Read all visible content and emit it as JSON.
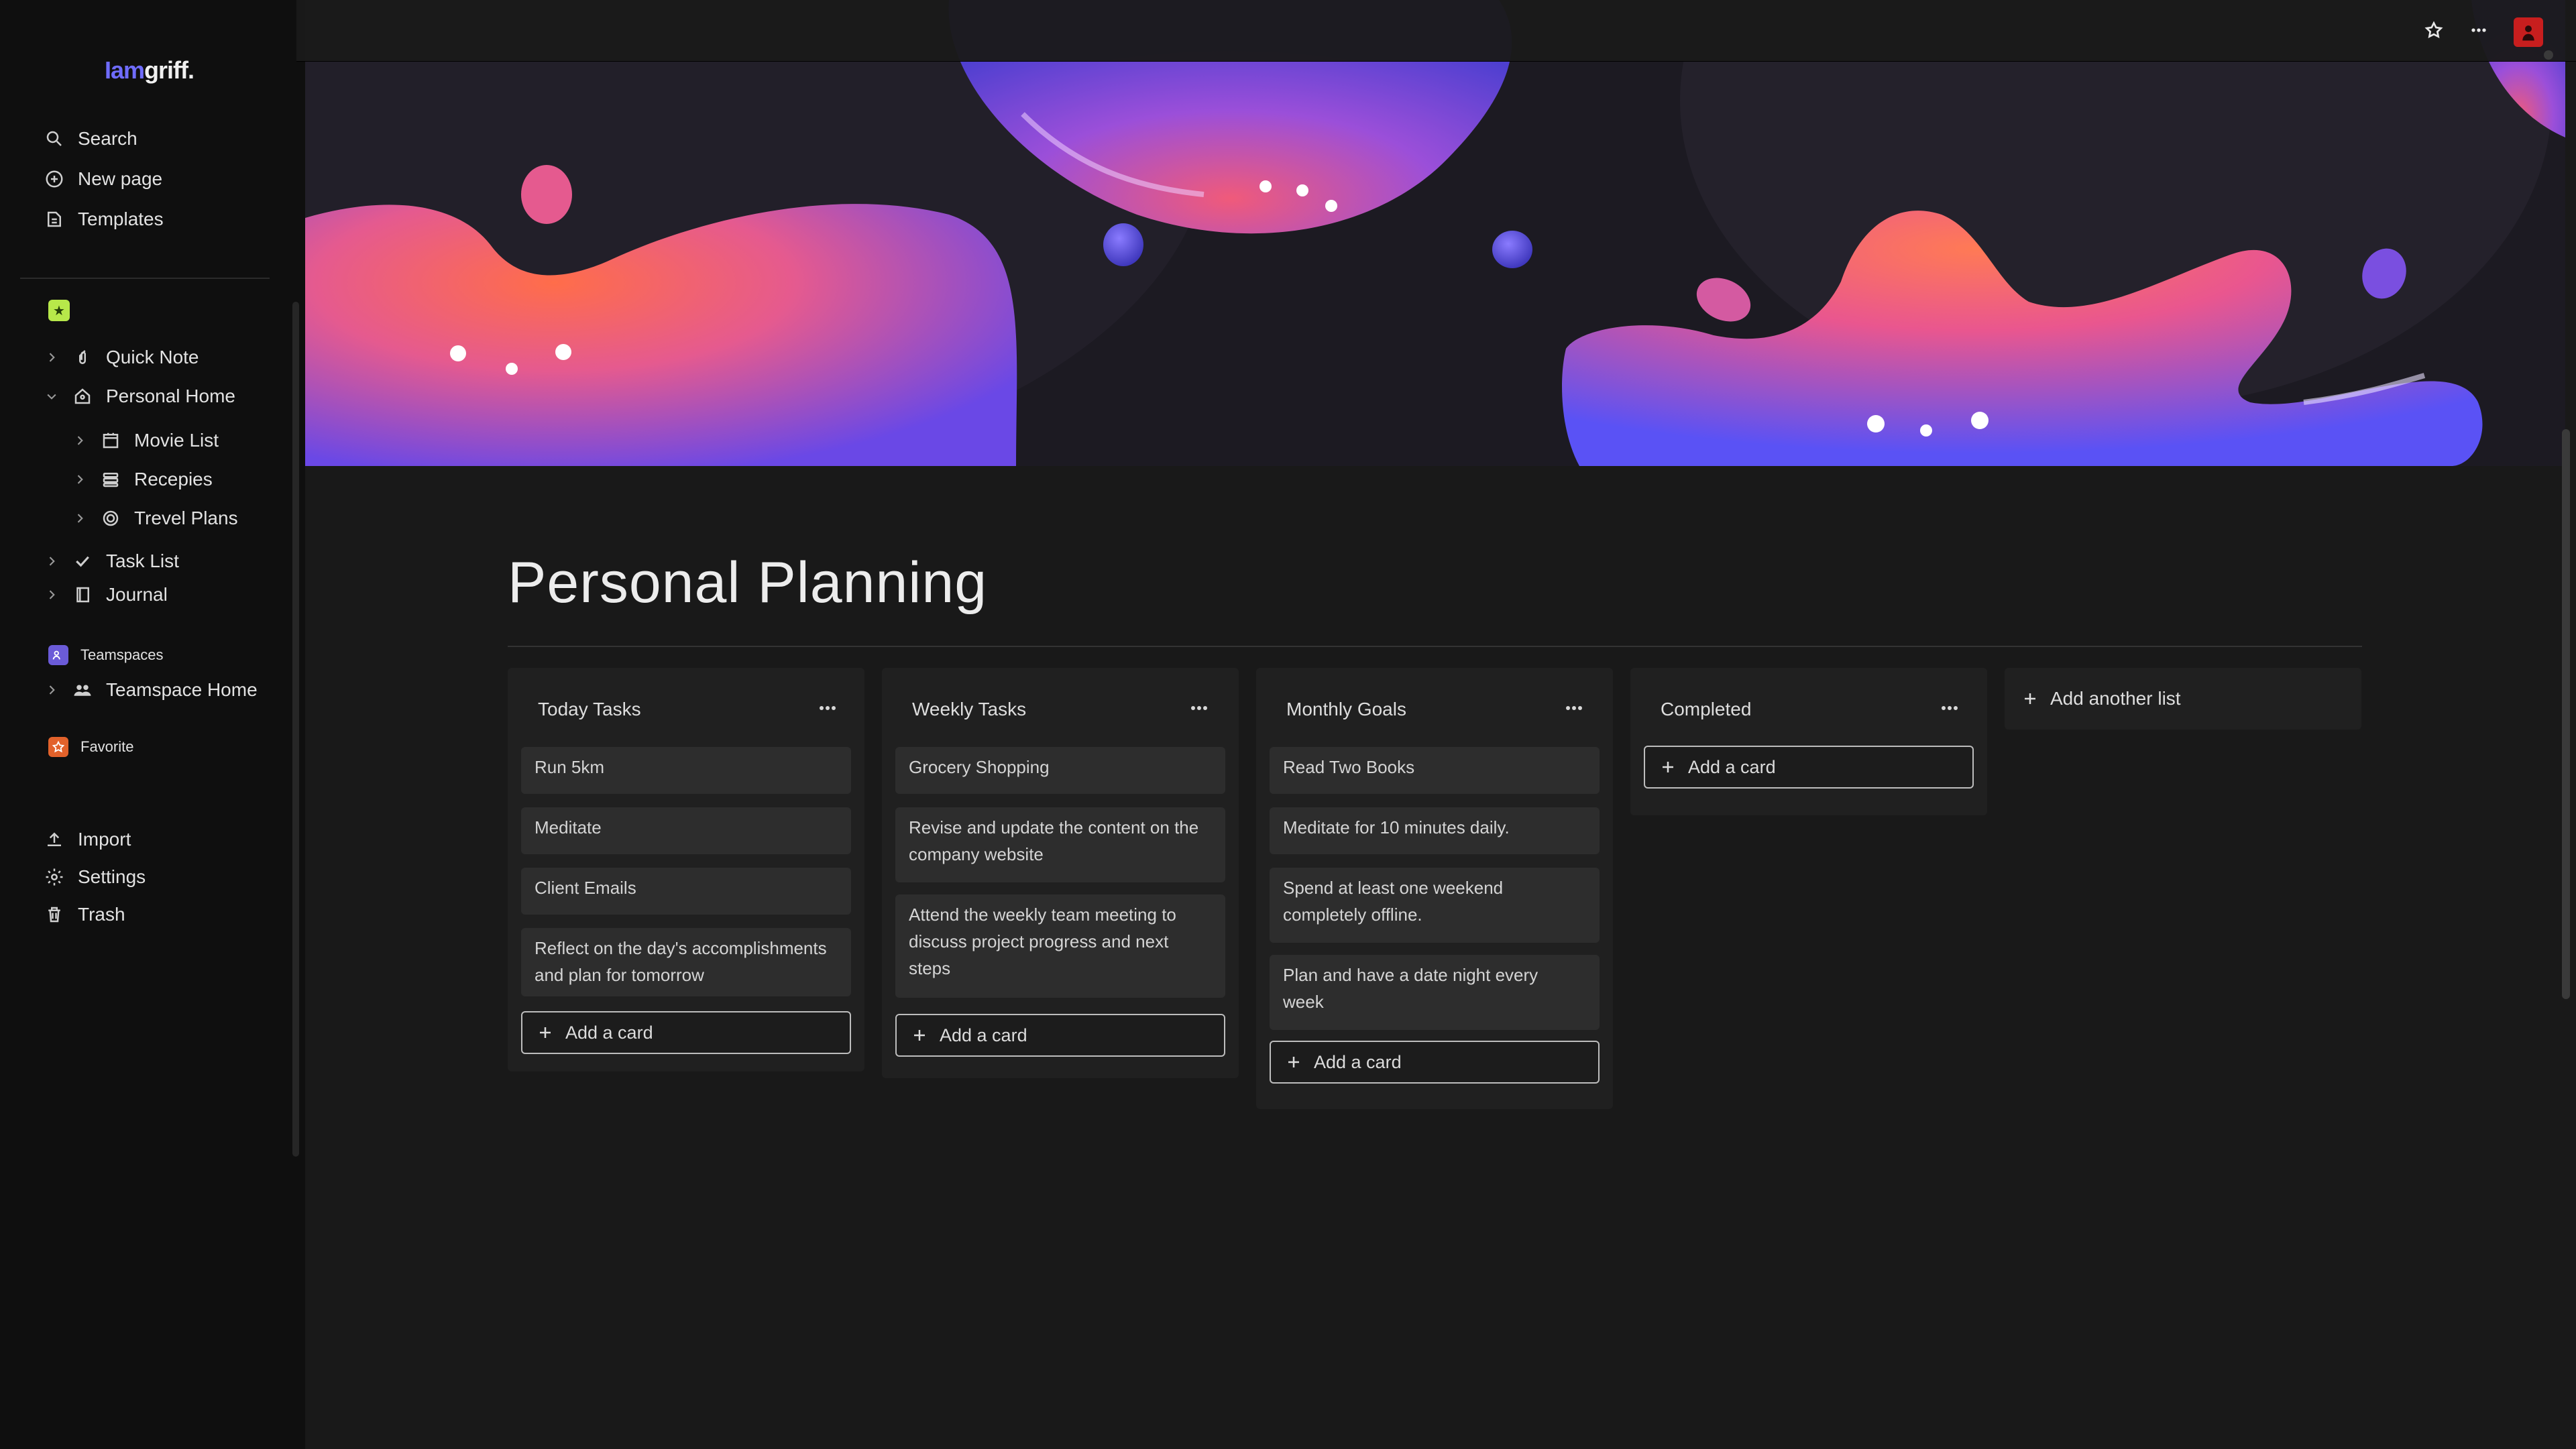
{
  "sidebar": {
    "logo_prefix": "Iam",
    "logo_suffix": "griff.",
    "top_items": [
      {
        "label": "Search",
        "icon": "search-icon"
      },
      {
        "label": "New page",
        "icon": "plus-circle-icon"
      },
      {
        "label": "Templates",
        "icon": "templates-icon"
      }
    ],
    "pages": [
      {
        "label": "Quick Note",
        "icon": "pin-icon"
      },
      {
        "label": "Personal Home",
        "icon": "home-icon"
      },
      {
        "label": "Movie List",
        "icon": "calendar-icon"
      },
      {
        "label": "Recepies",
        "icon": "stack-icon"
      },
      {
        "label": "Trevel Plans",
        "icon": "target-icon"
      },
      {
        "label": "Task List",
        "icon": "check-icon"
      },
      {
        "label": "Journal",
        "icon": "book-icon"
      }
    ],
    "teamspaces_label": "Teamspaces",
    "teamspace_home": "Teamspace Home",
    "favorite_label": "Favorite",
    "bottom_items": [
      {
        "label": "Import",
        "icon": "import-icon"
      },
      {
        "label": "Settings",
        "icon": "gear-icon"
      },
      {
        "label": "Trash",
        "icon": "trash-icon"
      }
    ]
  },
  "page": {
    "title": "Personal Planning"
  },
  "board": {
    "lists": [
      {
        "title": "Today Tasks",
        "cards": [
          "Run 5km",
          "Meditate",
          "Client Emails",
          "Reflect on the day's accomplishments and plan for tomorrow"
        ],
        "add_label": "Add a card"
      },
      {
        "title": "Weekly Tasks",
        "cards": [
          "Grocery Shopping",
          "Revise and update the content on the company website",
          "Attend the weekly team meeting to discuss project progress and next steps"
        ],
        "add_label": "Add a card"
      },
      {
        "title": "Monthly Goals",
        "cards": [
          "Read Two Books",
          "Meditate for 10 minutes daily.",
          "Spend at least one weekend completely offline.",
          "Plan and have a date night every week"
        ],
        "add_label": "Add a card"
      },
      {
        "title": "Completed",
        "cards": [],
        "add_label": "Add a card"
      }
    ],
    "add_list_label": "Add another list"
  },
  "colors": {
    "background": "#191919",
    "sidebar": "#0f0f0f",
    "list": "#202020",
    "card": "#2d2d2d",
    "accent": "#6f6cff"
  }
}
